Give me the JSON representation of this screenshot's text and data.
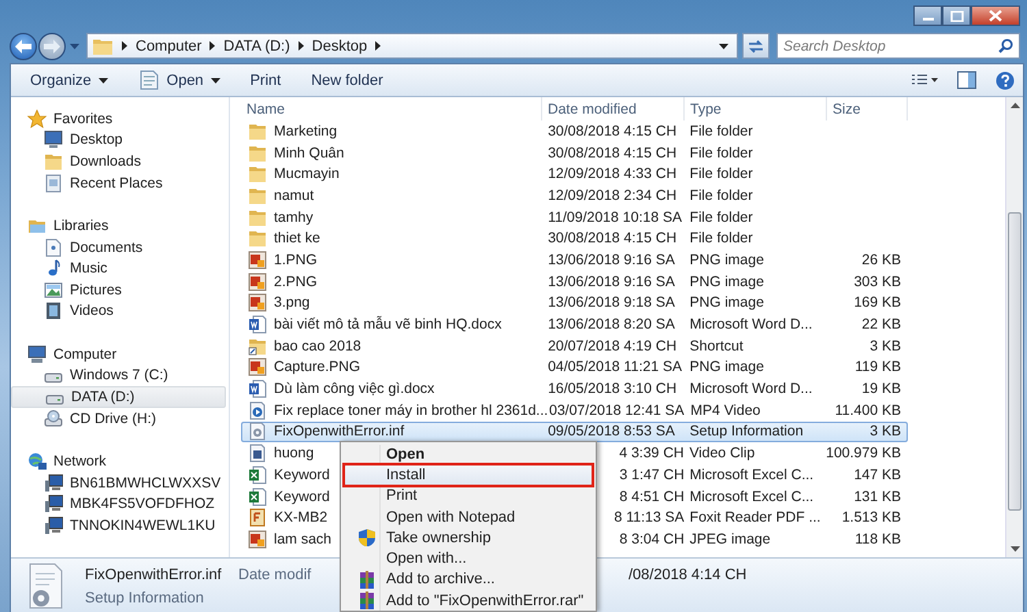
{
  "address": {
    "crumbs": [
      "Computer",
      "DATA (D:)",
      "Desktop"
    ]
  },
  "search": {
    "placeholder": "Search Desktop"
  },
  "toolbar": [
    {
      "label": "Organize",
      "kind": "menu"
    },
    {
      "label": "Open",
      "kind": "open"
    },
    {
      "label": "Print",
      "kind": "plain"
    },
    {
      "label": "New folder",
      "kind": "plain"
    }
  ],
  "sidebar": {
    "groups": [
      {
        "label": "Favorites",
        "children": [
          {
            "label": "Desktop",
            "selected": false
          },
          {
            "label": "Downloads",
            "selected": false
          },
          {
            "label": "Recent Places",
            "selected": false
          }
        ]
      },
      {
        "label": "Libraries",
        "children": [
          {
            "label": "Documents",
            "selected": false
          },
          {
            "label": "Music",
            "selected": false
          },
          {
            "label": "Pictures",
            "selected": false
          },
          {
            "label": "Videos",
            "selected": false
          }
        ]
      },
      {
        "label": "Computer",
        "children": [
          {
            "label": "Windows 7 (C:)",
            "selected": false
          },
          {
            "label": "DATA (D:)",
            "selected": true
          },
          {
            "label": "CD Drive (H:)",
            "selected": false
          }
        ]
      },
      {
        "label": "Network",
        "children": [
          {
            "label": "BN61BMWHCLWXXSV",
            "selected": false
          },
          {
            "label": "MBK4FS5VOFDFHOZ",
            "selected": false
          },
          {
            "label": "TNNOKIN4WEWL1KU",
            "selected": false
          }
        ]
      }
    ]
  },
  "table": {
    "columns": [
      "Name",
      "Date modified",
      "Type",
      "Size"
    ],
    "rows": [
      {
        "kind": "folder",
        "name": "Marketing",
        "date": "30/08/2018 4:15 CH",
        "type": "File folder",
        "size": "",
        "selected": false,
        "covered": false
      },
      {
        "kind": "folder",
        "name": "Minh Quân",
        "date": "30/08/2018 4:15 CH",
        "type": "File folder",
        "size": "",
        "selected": false,
        "covered": false
      },
      {
        "kind": "folder",
        "name": "Mucmayin",
        "date": "12/09/2018 4:33 CH",
        "type": "File folder",
        "size": "",
        "selected": false,
        "covered": false
      },
      {
        "kind": "folder",
        "name": "namut",
        "date": "12/09/2018 2:34 CH",
        "type": "File folder",
        "size": "",
        "selected": false,
        "covered": false
      },
      {
        "kind": "folder",
        "name": "tamhy",
        "date": "11/09/2018 10:18 SA",
        "type": "File folder",
        "size": "",
        "selected": false,
        "covered": false
      },
      {
        "kind": "folder",
        "name": "thiet ke",
        "date": "30/08/2018 4:15 CH",
        "type": "File folder",
        "size": "",
        "selected": false,
        "covered": false
      },
      {
        "kind": "image",
        "name": "1.PNG",
        "date": "13/06/2018 9:16 SA",
        "type": "PNG image",
        "size": "26 KB",
        "selected": false,
        "covered": false
      },
      {
        "kind": "image",
        "name": "2.PNG",
        "date": "13/06/2018 9:16 SA",
        "type": "PNG image",
        "size": "303 KB",
        "selected": false,
        "covered": false
      },
      {
        "kind": "image",
        "name": "3.png",
        "date": "13/06/2018 9:18 SA",
        "type": "PNG image",
        "size": "169 KB",
        "selected": false,
        "covered": false
      },
      {
        "kind": "word",
        "name": "bài viết mô tả mẫu vẽ binh HQ.docx",
        "date": "13/06/2018 8:20 SA",
        "type": "Microsoft Word D...",
        "size": "22 KB",
        "selected": false,
        "covered": false
      },
      {
        "kind": "shortcut",
        "name": "bao cao 2018",
        "date": "20/07/2018 4:19 CH",
        "type": "Shortcut",
        "size": "3 KB",
        "selected": false,
        "covered": false
      },
      {
        "kind": "image",
        "name": "Capture.PNG",
        "date": "04/05/2018 11:21 SA",
        "type": "PNG image",
        "size": "119 KB",
        "selected": false,
        "covered": false
      },
      {
        "kind": "word",
        "name": "Dù làm công việc gì.docx",
        "date": "16/05/2018 3:10 CH",
        "type": "Microsoft Word D...",
        "size": "19 KB",
        "selected": false,
        "covered": false
      },
      {
        "kind": "video",
        "name": "Fix replace toner máy in brother hl 2361d...",
        "date": "03/07/2018 12:41 SA",
        "type": "MP4 Video",
        "size": "11.400 KB",
        "selected": false,
        "covered": false
      },
      {
        "kind": "setup",
        "name": "FixOpenwithError.inf",
        "date": "09/05/2018 8:53 SA",
        "type": "Setup Information",
        "size": "3 KB",
        "selected": true,
        "covered": false
      },
      {
        "kind": "clip",
        "name": "huong",
        "date": "4 3:39 CH",
        "type": "Video Clip",
        "size": "100.979 KB",
        "selected": false,
        "covered": true
      },
      {
        "kind": "excel",
        "name": "Keyword",
        "date": "3 1:47 CH",
        "type": "Microsoft Excel C...",
        "size": "147 KB",
        "selected": false,
        "covered": true
      },
      {
        "kind": "excel",
        "name": "Keyword",
        "date": "8 4:51 CH",
        "type": "Microsoft Excel C...",
        "size": "131 KB",
        "selected": false,
        "covered": true
      },
      {
        "kind": "pdf",
        "name": "KX-MB2",
        "date": "8 11:13 SA",
        "type": "Foxit Reader PDF ...",
        "size": "1.513 KB",
        "selected": false,
        "covered": true
      },
      {
        "kind": "image",
        "name": "lam sach",
        "date": "8 3:04 CH",
        "type": "JPEG image",
        "size": "118 KB",
        "selected": false,
        "covered": true
      }
    ]
  },
  "details": {
    "name": "FixOpenwithError.inf",
    "label": "Date modif",
    "value": "/08/2018 4:14 CH",
    "type": "Setup Information"
  },
  "context_menu": [
    {
      "label": "Open",
      "kind": "plain",
      "default": true,
      "selected": false,
      "outlined": false
    },
    {
      "label": "Install",
      "kind": "plain",
      "default": false,
      "selected": true,
      "outlined": true
    },
    {
      "label": "Print",
      "kind": "plain",
      "default": false,
      "selected": false,
      "outlined": false
    },
    {
      "label": "Open with Notepad",
      "kind": "plain",
      "default": false,
      "selected": false,
      "outlined": false
    },
    {
      "label": "Take ownership",
      "kind": "shield",
      "default": false,
      "selected": false,
      "outlined": false
    },
    {
      "label": "Open with...",
      "kind": "plain",
      "default": false,
      "selected": false,
      "outlined": false
    },
    {
      "label": "Add to archive...",
      "kind": "archive",
      "default": false,
      "selected": false,
      "outlined": false
    },
    {
      "label": "Add to \"FixOpenwithError.rar\"",
      "kind": "archive",
      "default": false,
      "selected": false,
      "outlined": false
    }
  ]
}
